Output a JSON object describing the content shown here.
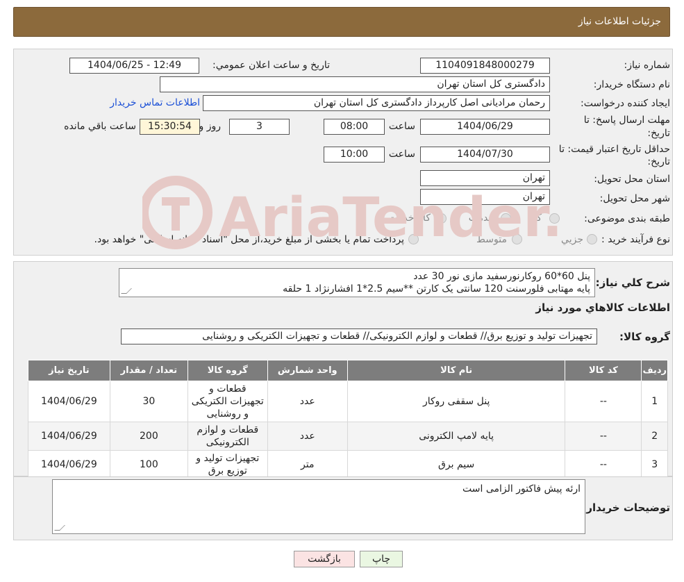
{
  "header": {
    "title": "جزئیات اطلاعات نیاز"
  },
  "form": {
    "need_number_label": "شماره نیاز:",
    "need_number": "1104091848000279",
    "announce_label": "تاریخ و ساعت اعلان عمومي:",
    "announce_value": "1404/06/25 - 12:49",
    "buyer_org_label": "نام دستگاه خريدار:",
    "buyer_org": "دادگستری کل استان تهران",
    "requester_label": "ايجاد کننده درخواست:",
    "requester": "رحمان مرادیانی اصل کارپرداز دادگستری کل استان تهران",
    "contact_link": "اطلاعات تماس خريدار",
    "deadline_label_1": "مهلت ارسال پاسخ: تا",
    "deadline_label_2": "تاريخ:",
    "deadline_date": "1404/06/29",
    "time_label": "ساعت",
    "deadline_time": "08:00",
    "days_value": "3",
    "days_label": "روز و",
    "remaining_time": "15:30:54",
    "remaining_label": "ساعت باقي مانده",
    "validity_label_1": "حداقل تاريخ اعتبار قيمت: تا",
    "validity_label_2": "تاريخ:",
    "validity_date": "1404/07/30",
    "validity_time": "10:00",
    "province_label": "استان محل تحويل:",
    "province": "تهران",
    "city_label": "شهر محل تحويل:",
    "city": "تهران",
    "category_label": "طبقه بندی موضوعی:",
    "category_options": [
      "کالا",
      "خدمت",
      "کالا/خدمت"
    ],
    "process_label": "نوع فرآيند خريد :",
    "process_options": [
      "جزيي",
      "متوسط"
    ],
    "process_note": "پرداخت تمام یا بخشی از مبلغ خرید،از محل \"اسناد خزانه اسلامی\" خواهد بود."
  },
  "summary": {
    "label": "شرح کلي نياز:",
    "lines": [
      "پنل 60*60 روکارنورسفید مازی نور 30 عدد",
      "پایه مهتابی فلورسنت  120 سانتی یک کارتن **سیم 2.5*1 افشارنژاد 1 حلقه"
    ],
    "goods_info_title": "اطلاعات کالاهاي مورد نياز",
    "group_label": "گروه کالا:",
    "group_value": "تجهیزات تولید و توزیع برق// قطعات و لوازم الکترونیکی// قطعات و تجهیزات الکتریکی و روشنایی"
  },
  "table": {
    "headers": [
      "رديف",
      "کد کالا",
      "نام کالا",
      "واحد شمارش",
      "گروه کالا",
      "تعداد / مقدار",
      "تاريخ نياز"
    ],
    "rows": [
      {
        "idx": "1",
        "code": "--",
        "name": "پنل سقفی روکار",
        "unit": "عدد",
        "group": "قطعات و تجهیزات الکتریکی و روشنایی",
        "qty": "30",
        "date": "1404/06/29"
      },
      {
        "idx": "2",
        "code": "--",
        "name": "پایه لامپ الکترونی",
        "unit": "عدد",
        "group": "قطعات و لوازم الکترونیکی",
        "qty": "200",
        "date": "1404/06/29"
      },
      {
        "idx": "3",
        "code": "--",
        "name": "سیم برق",
        "unit": "متر",
        "group": "تجهیزات تولید و توزیع برق",
        "qty": "100",
        "date": "1404/06/29"
      }
    ]
  },
  "notes": {
    "label": "توضيحات خريدار:",
    "text": "ارئه پیش فاکتور الزامی است"
  },
  "buttons": {
    "print": "چاپ",
    "back": "بازگشت"
  },
  "watermark": {
    "text": "AriaTender.neT"
  },
  "colors": {
    "header": "#8c6a3c",
    "watermark": "#e6c9c6",
    "print_btn": "#eaf7e2",
    "back_btn": "#fbe3e3"
  }
}
